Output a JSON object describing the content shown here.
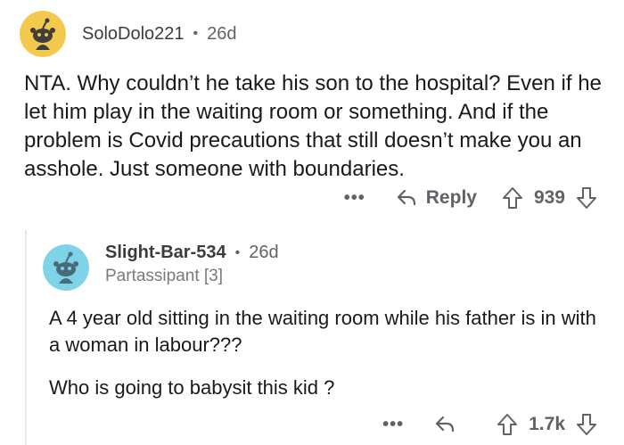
{
  "parent_comment": {
    "author": "SoloDolo221",
    "separator": "•",
    "age": "26d",
    "text": "NTA. Why couldn’t he take his son to the hospital? Even if he let him play in the waiting room or something. And if the problem is Covid precautions that still doesn’t make you an asshole. Just someone with boundaries.",
    "more_label": "•••",
    "reply_label": "Reply",
    "score": "939",
    "avatar_color": "#f2c94c"
  },
  "reply_comment": {
    "author": "Slight-Bar-534",
    "separator": "•",
    "age": "26d",
    "flair": "Partassipant [3]",
    "paragraphs": [
      "A 4 year old sitting in the waiting room while his father is in with a woman in labour???",
      "Who is going to babysit this kid ?"
    ],
    "more_label": "•••",
    "score": "1.7k",
    "avatar_color": "#7fd3e6"
  },
  "icons": {
    "reply": "reply-arrow-icon",
    "upvote": "upvote-arrow-icon",
    "downvote": "downvote-arrow-icon",
    "avatar": "snoo-avatar-icon"
  }
}
